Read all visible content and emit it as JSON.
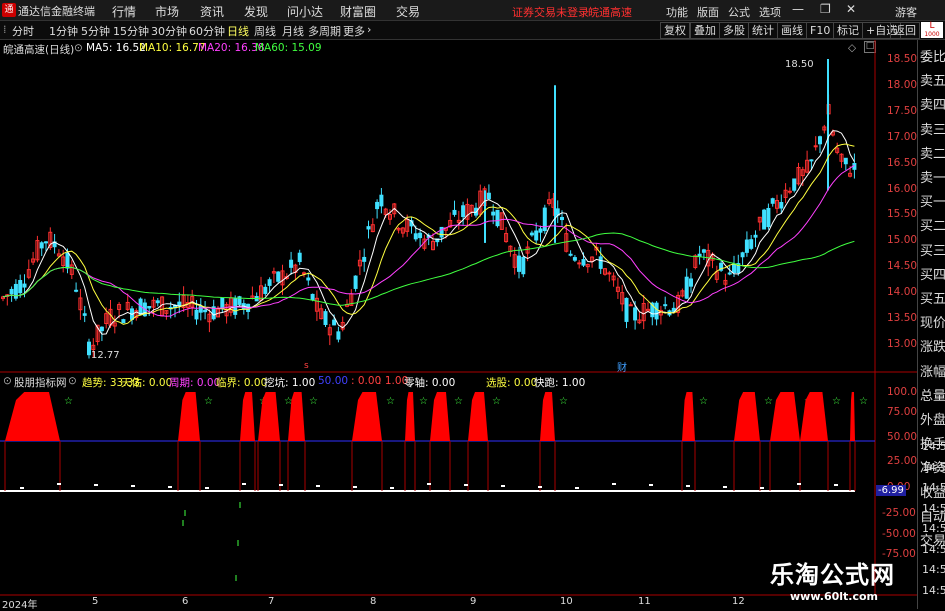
{
  "menubar": {
    "app_title": "通达信金融终端",
    "items": [
      "行情",
      "市场",
      "资讯",
      "发现",
      "问小达",
      "财富圈",
      "交易"
    ],
    "status_left": "证券交易未登录",
    "status_stock": "皖通高速",
    "right_items": [
      "功能",
      "版面",
      "公式",
      "选项"
    ],
    "user": "游客"
  },
  "toolbar": {
    "periods": [
      "分时",
      "1分钟",
      "5分钟",
      "15分钟",
      "30分钟",
      "60分钟",
      "日线",
      "周线",
      "月线",
      "多周期",
      "更多"
    ],
    "active_period": "日线",
    "right_buttons": [
      "复权",
      "叠加",
      "多股",
      "统计",
      "画线",
      "F10",
      "标记",
      "+自选",
      "返回"
    ]
  },
  "main_chart": {
    "title": "皖通高速(日线)",
    "ma": [
      {
        "label": "MA5: 16.52",
        "color": "#ffffff"
      },
      {
        "label": "MA10: 16.77",
        "color": "#ffff40"
      },
      {
        "label": "MA20: 16.38",
        "color": "#ff40ff"
      },
      {
        "label": "MA60: 15.09",
        "color": "#40ff40"
      }
    ],
    "high_label": "18.50",
    "low_label": "12.77",
    "marker_s": "s",
    "marker_cai": "财",
    "price_axis": [
      "18.50",
      "18.00",
      "17.50",
      "17.00",
      "16.50",
      "16.00",
      "15.50",
      "15.00",
      "14.50",
      "14.00",
      "13.50",
      "13.00"
    ]
  },
  "sub_chart": {
    "title": "股朋指标网",
    "params": [
      {
        "label": "趋势: 33.33",
        "color": "#ffff40"
      },
      {
        "label": "天佑: 0.00",
        "color": "#ffff40"
      },
      {
        "label": "周期: 0.00",
        "color": "#ff40ff"
      },
      {
        "label": "临界: 0.00",
        "color": "#ffff40"
      },
      {
        "label": "挖坑: 1.00",
        "color": "#ffffff"
      },
      {
        "label": "50.00",
        "color": "#4040ff"
      },
      {
        "label": ": 0.00",
        "color": "#ff4040"
      },
      {
        "label": ": 1.00",
        "color": "#ff4040"
      },
      {
        "label": "零轴: 0.00",
        "color": "#ffffff"
      },
      {
        "label": "选股: 0.00",
        "color": "#ffff40"
      },
      {
        "label": "快跑: 1.00",
        "color": "#ffffff"
      }
    ],
    "axis": [
      "100.0",
      "75.00",
      "50.00",
      "25.00",
      "0.00",
      "-25.00",
      "-50.00",
      "-75.00"
    ],
    "right_labels": [
      "14:56",
      "14:56",
      "14:56",
      "14:56",
      "14:56",
      "14:56",
      "14:56",
      "14:56"
    ],
    "current_value": "-6.99"
  },
  "sidebar": {
    "items": [
      "委比",
      "卖五",
      "卖四",
      "卖三",
      "卖二",
      "卖一",
      "买一",
      "买二",
      "买三",
      "买四",
      "买五",
      "现价",
      "涨跌",
      "涨幅",
      "总量",
      "外盘",
      "换手",
      "净资",
      "收益",
      "自动",
      "交易"
    ]
  },
  "dates": [
    "2024年",
    "5",
    "6",
    "7",
    "8",
    "9",
    "10",
    "11",
    "12"
  ],
  "watermark": {
    "title": "乐淘公式网",
    "url": "www.60lt.com"
  },
  "colors": {
    "up": "#ff3030",
    "down": "#40e0ff",
    "ma5": "#ffffff",
    "ma10": "#ffff40",
    "ma20": "#ff40ff",
    "ma60": "#40ff40",
    "blue_line": "#3030ff"
  }
}
